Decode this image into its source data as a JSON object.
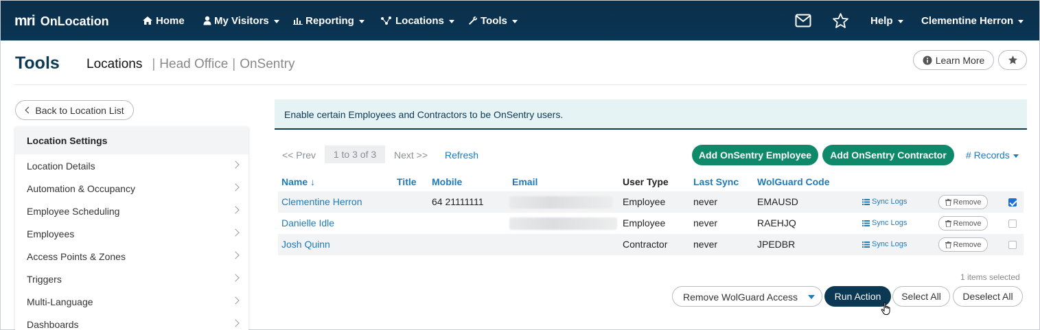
{
  "nav": {
    "brand_mark": "mri",
    "brand_name": "OnLocation",
    "home": "Home",
    "my_visitors": "My Visitors",
    "reporting": "Reporting",
    "locations": "Locations",
    "tools": "Tools",
    "help": "Help",
    "user": "Clementine Herron"
  },
  "header": {
    "title": "Tools",
    "crumb_current": "Locations",
    "crumb_1": "Head Office",
    "crumb_2": "OnSentry",
    "learn_more": "Learn More"
  },
  "sidebar": {
    "back": "Back to Location List",
    "heading": "Location Settings",
    "items": [
      "Location Details",
      "Automation & Occupancy",
      "Employee Scheduling",
      "Employees",
      "Access Points & Zones",
      "Triggers",
      "Multi-Language",
      "Dashboards"
    ]
  },
  "main": {
    "info": "Enable certain Employees and Contractors to be OnSentry users.",
    "pager": {
      "prev": "<< Prev",
      "count": "1 to 3 of 3",
      "next": "Next >>",
      "refresh": "Refresh"
    },
    "add_employee": "Add OnSentry Employee",
    "add_contractor": "Add OnSentry Contractor",
    "records": "# Records",
    "columns": {
      "name": "Name ↓",
      "title": "Title",
      "mobile": "Mobile",
      "email": "Email",
      "user_type": "User Type",
      "last_sync": "Last Sync",
      "wolguard": "WolGuard Code"
    },
    "rows": [
      {
        "name": "Clementine Herron",
        "title": "",
        "mobile": "64 21111111",
        "user_type": "Employee",
        "last_sync": "never",
        "code": "EMAUSD",
        "sync_logs": "Sync Logs",
        "remove": "Remove",
        "checked": true
      },
      {
        "name": "Danielle Idle",
        "title": "",
        "mobile": "",
        "user_type": "Employee",
        "last_sync": "never",
        "code": "RAEHJQ",
        "sync_logs": "Sync Logs",
        "remove": "Remove",
        "checked": false
      },
      {
        "name": "Josh Quinn",
        "title": "",
        "mobile": "",
        "user_type": "Contractor",
        "last_sync": "never",
        "code": "JPEDBR",
        "sync_logs": "Sync Logs",
        "remove": "Remove",
        "checked": false
      }
    ],
    "selected_count": "1 items selected",
    "action": "Remove WolGuard Access",
    "run_action": "Run Action",
    "select_all": "Select All",
    "deselect_all": "Deselect All"
  },
  "colors": {
    "nav_bg": "#0b2f4a",
    "accent_blue": "#1f7ab8",
    "green": "#0e8a6b",
    "dark": "#0b3954"
  }
}
